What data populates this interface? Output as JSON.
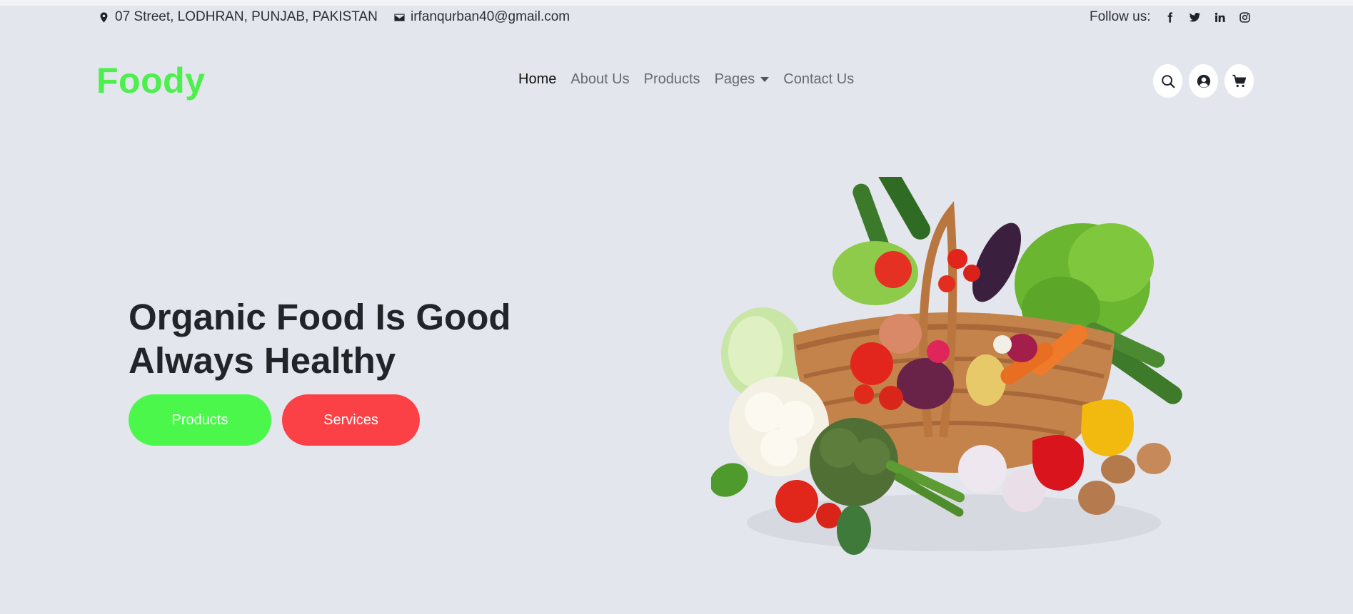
{
  "topbar": {
    "address": "07 Street, LODHRAN, PUNJAB, PAKISTAN",
    "email": "irfanqurban40@gmail.com",
    "follow_label": "Follow us:",
    "social_icons": [
      "facebook-icon",
      "twitter-icon",
      "linkedin-icon",
      "instagram-icon"
    ]
  },
  "brand": {
    "logo": "Foody",
    "color": "#4cf04c"
  },
  "nav": {
    "items": [
      {
        "label": "Home",
        "active": true
      },
      {
        "label": "About Us"
      },
      {
        "label": "Products"
      },
      {
        "label": "Pages",
        "dropdown": true
      },
      {
        "label": "Contact Us"
      }
    ],
    "icons": [
      "search-icon",
      "user-icon",
      "cart-icon"
    ]
  },
  "hero": {
    "title_line1": "Organic Food Is Good",
    "title_line2": "Always Healthy",
    "primary_button": "Products",
    "secondary_button": "Services",
    "primary_color": "#4cf74c",
    "secondary_color": "#fb4146"
  },
  "colors": {
    "background": "#e3e6ec"
  }
}
